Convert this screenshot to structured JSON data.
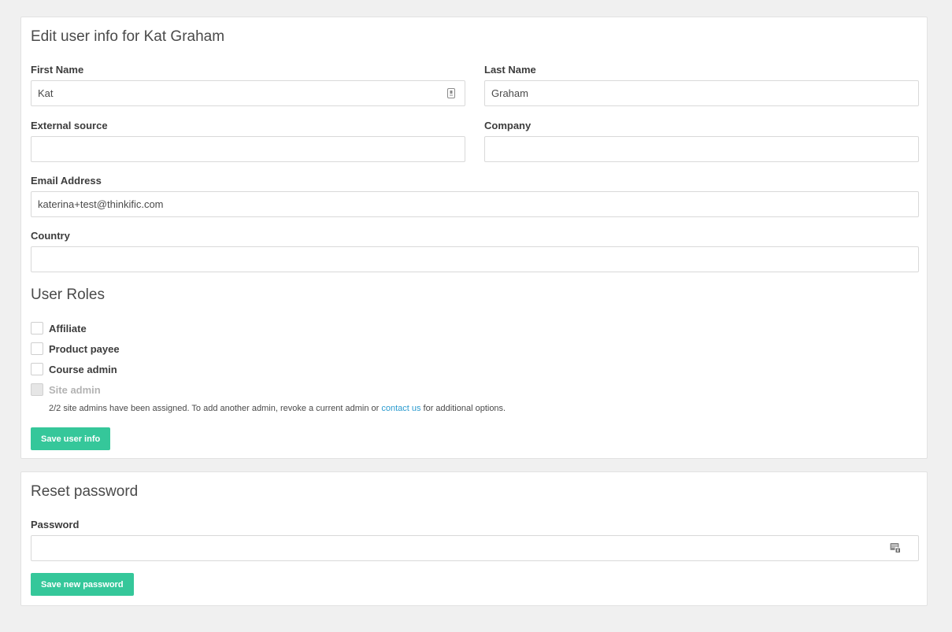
{
  "edit_card": {
    "title": "Edit user info for Kat Graham",
    "first_name": {
      "label": "First Name",
      "value": "Kat"
    },
    "last_name": {
      "label": "Last Name",
      "value": "Graham"
    },
    "external_source": {
      "label": "External source",
      "value": ""
    },
    "company": {
      "label": "Company",
      "value": ""
    },
    "email": {
      "label": "Email Address",
      "value": "katerina+test@thinkific.com"
    },
    "country": {
      "label": "Country",
      "value": ""
    },
    "roles_title": "User Roles",
    "roles": [
      {
        "label": "Affiliate",
        "checked": false,
        "disabled": false
      },
      {
        "label": "Product payee",
        "checked": false,
        "disabled": false
      },
      {
        "label": "Course admin",
        "checked": false,
        "disabled": false
      },
      {
        "label": "Site admin",
        "checked": false,
        "disabled": true
      }
    ],
    "site_admin_note": {
      "before": "2/2 site admins have been assigned. To add another admin, revoke a current admin or ",
      "link": "contact us",
      "after": " for additional options."
    },
    "save_label": "Save user info"
  },
  "reset_card": {
    "title": "Reset password",
    "password": {
      "label": "Password",
      "value": ""
    },
    "save_label": "Save new password"
  },
  "colors": {
    "background": "#f0f0f0",
    "button": "#35c79a",
    "link": "#2a9bcf"
  },
  "icons": {
    "first_name_field": "contact-card-icon",
    "password_field": "password-manager-icon"
  }
}
